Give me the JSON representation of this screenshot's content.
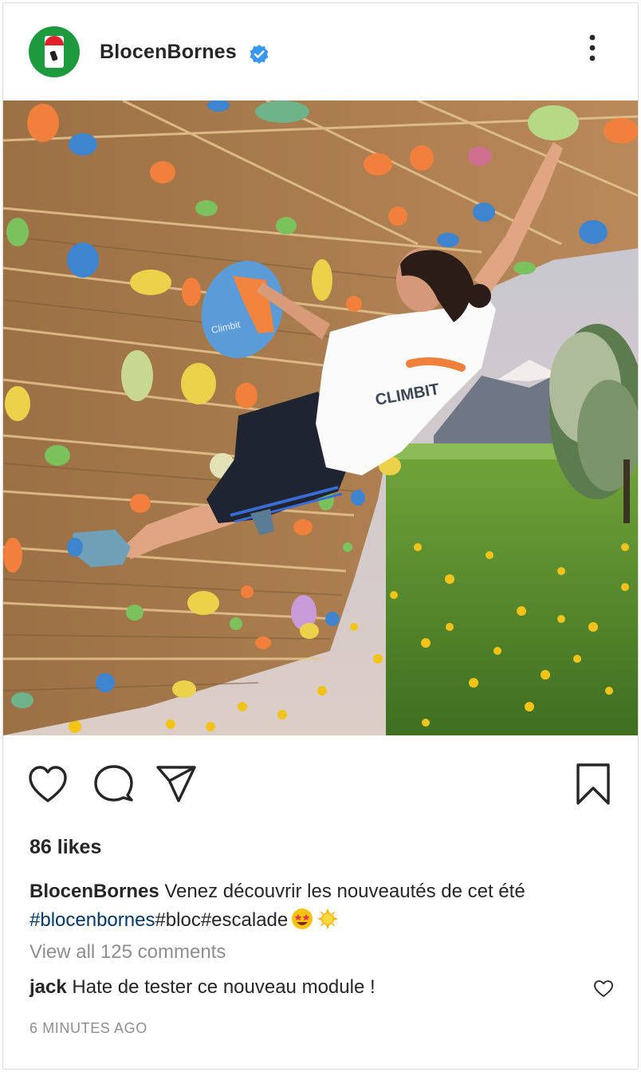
{
  "post": {
    "username": "BlocenBornes",
    "avatar_icon": "logo-avatar",
    "verified_icon": "verified-badge-icon",
    "more_icon": "more-vertical-icon",
    "colors": {
      "accent_blue": "#3897f0",
      "hashtag": "#00376b",
      "muted": "#8e8e8e",
      "text": "#262626"
    }
  },
  "photo": {
    "shirt_text": "CLIMBIT",
    "volume_text": "Climbit"
  },
  "actions": {
    "like_icon": "heart-icon",
    "comment_icon": "comment-bubble-icon",
    "share_icon": "paper-plane-icon",
    "save_icon": "bookmark-icon"
  },
  "stats": {
    "likes": "86 likes"
  },
  "caption": {
    "user": "BlocenBornes",
    "text": " Venez découvrir les nouveautés de cet été",
    "hashtags": "#blocenbornes",
    "rest": "#bloc#escalade",
    "emoji1": "star-struck-emoji",
    "emoji2": "sun-emoji"
  },
  "comments": {
    "view_all": "View all 125 comments",
    "items": [
      {
        "user": "jack",
        "text": " Hate de tester ce nouveau module !"
      }
    ]
  },
  "timestamp": "6 MINUTES AGO"
}
